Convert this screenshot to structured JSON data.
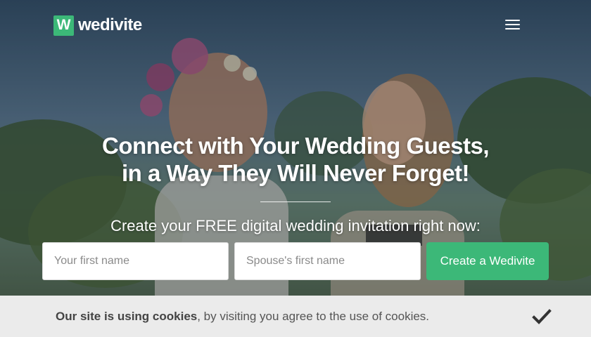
{
  "brand": {
    "logo_letter": "W",
    "name": "wedivite",
    "accent_color": "#3cb878"
  },
  "header": {
    "menu_icon": "hamburger-menu-icon"
  },
  "hero": {
    "headline_line1": "Connect with Your Wedding Guests,",
    "headline_line2": "in a Way They Will Never Forget!",
    "subline": "Create your FREE digital wedding invitation right now:"
  },
  "form": {
    "first_name_placeholder": "Your first name",
    "spouse_name_placeholder": "Spouse's first name",
    "submit_label": "Create a Wedivite"
  },
  "cookie_bar": {
    "bold_text": "Our site is using cookies",
    "rest_text": ", by visiting you agree to the use of cookies.",
    "dismiss_icon": "checkmark-icon"
  }
}
